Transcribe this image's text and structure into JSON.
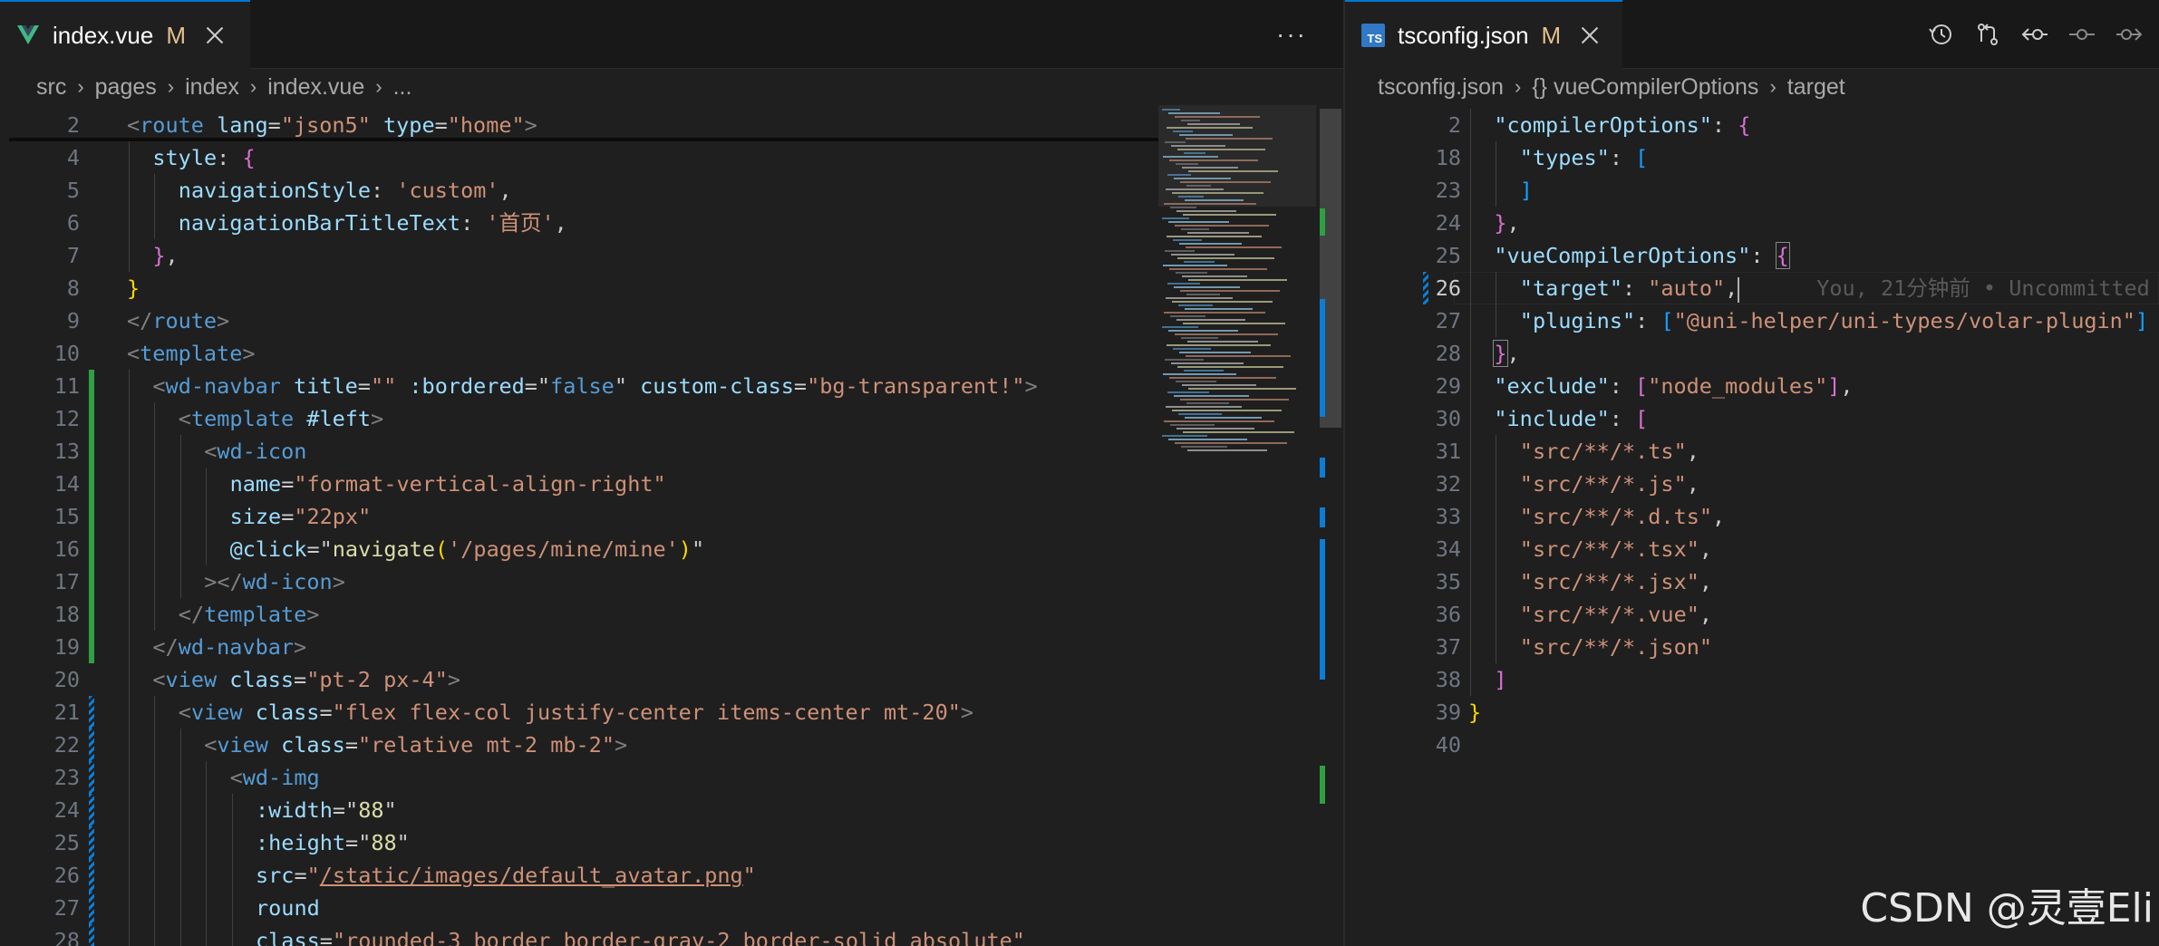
{
  "left_tab": {
    "filename": "index.vue",
    "status": "M"
  },
  "more_label": "···",
  "left_breadcrumb": [
    "src",
    "pages",
    "index",
    "index.vue",
    "..."
  ],
  "left_lines": [
    {
      "n": "2",
      "segs": [
        [
          "t",
          "<"
        ],
        [
          "tn",
          "route"
        ],
        [
          "pl",
          " "
        ],
        [
          "an",
          "lang"
        ],
        [
          "pl",
          "="
        ],
        [
          "av",
          "\"json5\""
        ],
        [
          "pl",
          " "
        ],
        [
          "an",
          "type"
        ],
        [
          "pl",
          "="
        ],
        [
          "av",
          "\"home\""
        ],
        [
          "t",
          ">"
        ]
      ]
    },
    {
      "n": "4",
      "segs": [
        [
          "pn",
          "style"
        ],
        [
          "pl",
          ": "
        ],
        [
          "b2",
          "{"
        ]
      ]
    },
    {
      "n": "5",
      "segs": [
        [
          "pn",
          "navigationStyle"
        ],
        [
          "pl",
          ": "
        ],
        [
          "ps",
          "'custom'"
        ],
        [
          "pl",
          ","
        ]
      ]
    },
    {
      "n": "6",
      "segs": [
        [
          "pn",
          "navigationBarTitleText"
        ],
        [
          "pl",
          ": "
        ],
        [
          "ps",
          "'首页'"
        ],
        [
          "pl",
          ","
        ]
      ]
    },
    {
      "n": "7",
      "segs": [
        [
          "b2",
          "}"
        ],
        [
          "pl",
          ","
        ]
      ]
    },
    {
      "n": "8",
      "segs": [
        [
          "b1",
          "}"
        ]
      ]
    },
    {
      "n": "9",
      "segs": [
        [
          "t",
          "</"
        ],
        [
          "tn",
          "route"
        ],
        [
          "t",
          ">"
        ]
      ]
    },
    {
      "n": "10",
      "segs": [
        [
          "t",
          "<"
        ],
        [
          "tn",
          "template"
        ],
        [
          "t",
          ">"
        ]
      ]
    },
    {
      "n": "11",
      "segs": [
        [
          "t",
          "<"
        ],
        [
          "tn",
          "wd-navbar"
        ],
        [
          "pl",
          " "
        ],
        [
          "an",
          "title"
        ],
        [
          "pl",
          "="
        ],
        [
          "av",
          "\"\""
        ],
        [
          "pl",
          " "
        ],
        [
          "an",
          ":bordered"
        ],
        [
          "pl",
          "="
        ],
        [
          "pl",
          "\""
        ],
        [
          "tn",
          "false"
        ],
        [
          "pl",
          "\""
        ],
        [
          "pl",
          " "
        ],
        [
          "an",
          "custom-class"
        ],
        [
          "pl",
          "="
        ],
        [
          "av",
          "\"bg-transparent!\""
        ],
        [
          "t",
          ">"
        ]
      ]
    },
    {
      "n": "12",
      "segs": [
        [
          "t",
          "<"
        ],
        [
          "tn",
          "template"
        ],
        [
          "pl",
          " "
        ],
        [
          "an",
          "#left"
        ],
        [
          "t",
          ">"
        ]
      ]
    },
    {
      "n": "13",
      "segs": [
        [
          "t",
          "<"
        ],
        [
          "tn",
          "wd-icon"
        ]
      ]
    },
    {
      "n": "14",
      "segs": [
        [
          "an",
          "name"
        ],
        [
          "pl",
          "="
        ],
        [
          "av",
          "\"format-vertical-align-right\""
        ]
      ]
    },
    {
      "n": "15",
      "segs": [
        [
          "an",
          "size"
        ],
        [
          "pl",
          "="
        ],
        [
          "av",
          "\"22px\""
        ]
      ]
    },
    {
      "n": "16",
      "segs": [
        [
          "an",
          "@click"
        ],
        [
          "pl",
          "=\""
        ],
        [
          "fn",
          "navigate"
        ],
        [
          "b1",
          "("
        ],
        [
          "ps",
          "'/pages/mine/mine'"
        ],
        [
          "b1",
          ")"
        ],
        [
          "pl",
          "\""
        ]
      ]
    },
    {
      "n": "17",
      "segs": [
        [
          "t",
          "></"
        ],
        [
          "tn",
          "wd-icon"
        ],
        [
          "t",
          ">"
        ]
      ]
    },
    {
      "n": "18",
      "segs": [
        [
          "t",
          "</"
        ],
        [
          "tn",
          "template"
        ],
        [
          "t",
          ">"
        ]
      ]
    },
    {
      "n": "19",
      "segs": [
        [
          "t",
          "</"
        ],
        [
          "tn",
          "wd-navbar"
        ],
        [
          "t",
          ">"
        ]
      ]
    },
    {
      "n": "20",
      "segs": [
        [
          "t",
          "<"
        ],
        [
          "tn",
          "view"
        ],
        [
          "pl",
          " "
        ],
        [
          "an",
          "class"
        ],
        [
          "pl",
          "="
        ],
        [
          "av",
          "\"pt-2 px-4\""
        ],
        [
          "t",
          ">"
        ]
      ]
    },
    {
      "n": "21",
      "segs": [
        [
          "t",
          "<"
        ],
        [
          "tn",
          "view"
        ],
        [
          "pl",
          " "
        ],
        [
          "an",
          "class"
        ],
        [
          "pl",
          "="
        ],
        [
          "av",
          "\"flex flex-col justify-center items-center mt-20\""
        ],
        [
          "t",
          ">"
        ]
      ]
    },
    {
      "n": "22",
      "segs": [
        [
          "t",
          "<"
        ],
        [
          "tn",
          "view"
        ],
        [
          "pl",
          " "
        ],
        [
          "an",
          "class"
        ],
        [
          "pl",
          "="
        ],
        [
          "av",
          "\"relative mt-2 mb-2\""
        ],
        [
          "t",
          ">"
        ]
      ]
    },
    {
      "n": "23",
      "segs": [
        [
          "t",
          "<"
        ],
        [
          "tn",
          "wd-img"
        ]
      ]
    },
    {
      "n": "24",
      "segs": [
        [
          "an",
          ":width"
        ],
        [
          "pl",
          "=\""
        ],
        [
          "fn",
          "88"
        ],
        [
          "pl",
          "\""
        ]
      ]
    },
    {
      "n": "25",
      "segs": [
        [
          "an",
          ":height"
        ],
        [
          "pl",
          "=\""
        ],
        [
          "fn",
          "88"
        ],
        [
          "pl",
          "\""
        ]
      ]
    },
    {
      "n": "26",
      "segs": [
        [
          "an",
          "src"
        ],
        [
          "pl",
          "="
        ],
        [
          "av",
          "\""
        ],
        [
          "avu",
          "/static/images/default_avatar.png"
        ],
        [
          "av",
          "\""
        ]
      ]
    },
    {
      "n": "27",
      "segs": [
        [
          "an",
          "round"
        ]
      ]
    },
    {
      "n": "28",
      "segs": [
        [
          "an",
          "class"
        ],
        [
          "pl",
          "="
        ],
        [
          "av",
          "\"rounded-3 border border-gray-2 border-solid absolute\""
        ]
      ]
    }
  ],
  "right_tab": {
    "filename": "tsconfig.json",
    "status": "M"
  },
  "right_breadcrumb": [
    "tsconfig.json",
    "{} vueCompilerOptions",
    "target"
  ],
  "right_lines": [
    {
      "n": "2",
      "segs": [
        [
          "jk",
          "\"compilerOptions\""
        ],
        [
          "pl",
          ": "
        ],
        [
          "b2",
          "{"
        ]
      ]
    },
    {
      "n": "18",
      "segs": [
        [
          "jk",
          "\"types\""
        ],
        [
          "pl",
          ": "
        ],
        [
          "b3",
          "["
        ]
      ]
    },
    {
      "n": "23",
      "segs": [
        [
          "b3",
          "]"
        ]
      ]
    },
    {
      "n": "24",
      "segs": [
        [
          "b2",
          "}"
        ],
        [
          "pl",
          ","
        ]
      ]
    },
    {
      "n": "25",
      "segs": [
        [
          "jk",
          "\"vueCompilerOptions\""
        ],
        [
          "pl",
          ": "
        ],
        [
          "b2box",
          "{"
        ]
      ]
    },
    {
      "n": "26",
      "segs": [
        [
          "jk",
          "\"target\""
        ],
        [
          "pl",
          ": "
        ],
        [
          "js",
          "\"auto\""
        ],
        [
          "pl",
          ","
        ],
        [
          "cursor",
          ""
        ],
        [
          "blame",
          "      You, 21分钟前 • Uncommitted"
        ]
      ]
    },
    {
      "n": "27",
      "segs": [
        [
          "jk",
          "\"plugins\""
        ],
        [
          "pl",
          ": "
        ],
        [
          "b3",
          "["
        ],
        [
          "js",
          "\"@uni-helper/uni-types/volar-plugin\""
        ],
        [
          "b3",
          "]"
        ]
      ]
    },
    {
      "n": "28",
      "segs": [
        [
          "b2box",
          "}"
        ],
        [
          "pl",
          ","
        ]
      ]
    },
    {
      "n": "29",
      "segs": [
        [
          "jk",
          "\"exclude\""
        ],
        [
          "pl",
          ": "
        ],
        [
          "b2",
          "["
        ],
        [
          "js",
          "\"node_modules\""
        ],
        [
          "b2",
          "]"
        ],
        [
          "pl",
          ","
        ]
      ]
    },
    {
      "n": "30",
      "segs": [
        [
          "jk",
          "\"include\""
        ],
        [
          "pl",
          ": "
        ],
        [
          "b2",
          "["
        ]
      ]
    },
    {
      "n": "31",
      "segs": [
        [
          "js",
          "\"src/**/*.ts\""
        ],
        [
          "pl",
          ","
        ]
      ]
    },
    {
      "n": "32",
      "segs": [
        [
          "js",
          "\"src/**/*.js\""
        ],
        [
          "pl",
          ","
        ]
      ]
    },
    {
      "n": "33",
      "segs": [
        [
          "js",
          "\"src/**/*.d.ts\""
        ],
        [
          "pl",
          ","
        ]
      ]
    },
    {
      "n": "34",
      "segs": [
        [
          "js",
          "\"src/**/*.tsx\""
        ],
        [
          "pl",
          ","
        ]
      ]
    },
    {
      "n": "35",
      "segs": [
        [
          "js",
          "\"src/**/*.jsx\""
        ],
        [
          "pl",
          ","
        ]
      ]
    },
    {
      "n": "36",
      "segs": [
        [
          "js",
          "\"src/**/*.vue\""
        ],
        [
          "pl",
          ","
        ]
      ]
    },
    {
      "n": "37",
      "segs": [
        [
          "js",
          "\"src/**/*.json\""
        ]
      ]
    },
    {
      "n": "38",
      "segs": [
        [
          "b2",
          "]"
        ]
      ]
    },
    {
      "n": "39",
      "segs": [
        [
          "b1",
          "}"
        ]
      ]
    },
    {
      "n": "40",
      "segs": []
    }
  ],
  "current_line_right": "26",
  "watermark": "CSDN @灵壹Eli",
  "colors": {
    "accent": "#0078d4",
    "modified": "#e2c08d",
    "added_bar": "#2ea043",
    "changed_bar": "#0c7dd6"
  }
}
